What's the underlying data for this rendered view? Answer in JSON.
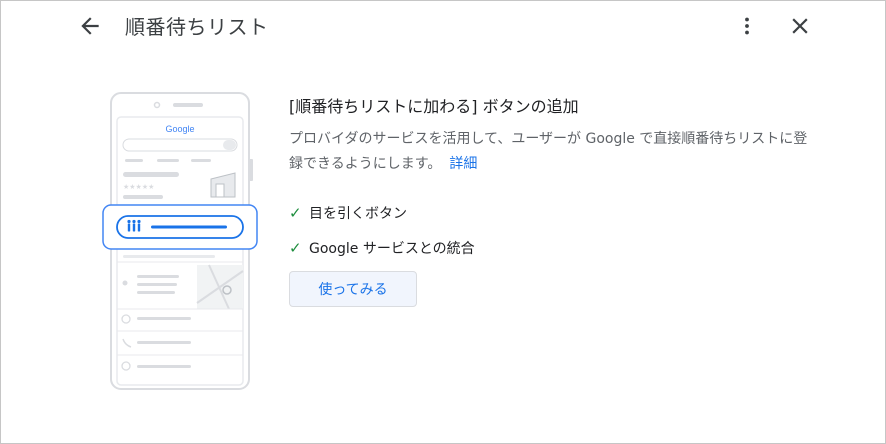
{
  "header": {
    "title": "順番待ちリスト",
    "back_icon": "arrow-back-icon",
    "more_icon": "more-vert-icon",
    "close_icon": "close-icon"
  },
  "illustration": {
    "logo_text": "Google"
  },
  "content": {
    "heading": "[順番待ちリストに加わる] ボタンの追加",
    "description": "プロバイダのサービスを活用して、ユーザーが Google で直接順番待ちリストに登録できるようにします。",
    "details_link": "詳細",
    "features": [
      {
        "label": "目を引くボタン",
        "icon": "check-icon"
      },
      {
        "label": "Google サービスとの統合",
        "icon": "check-icon"
      }
    ],
    "try_button": "使ってみる"
  },
  "colors": {
    "accent": "#1a73e8",
    "check": "#1e8e3e",
    "text": "#202124",
    "secondary": "#5f6368"
  }
}
